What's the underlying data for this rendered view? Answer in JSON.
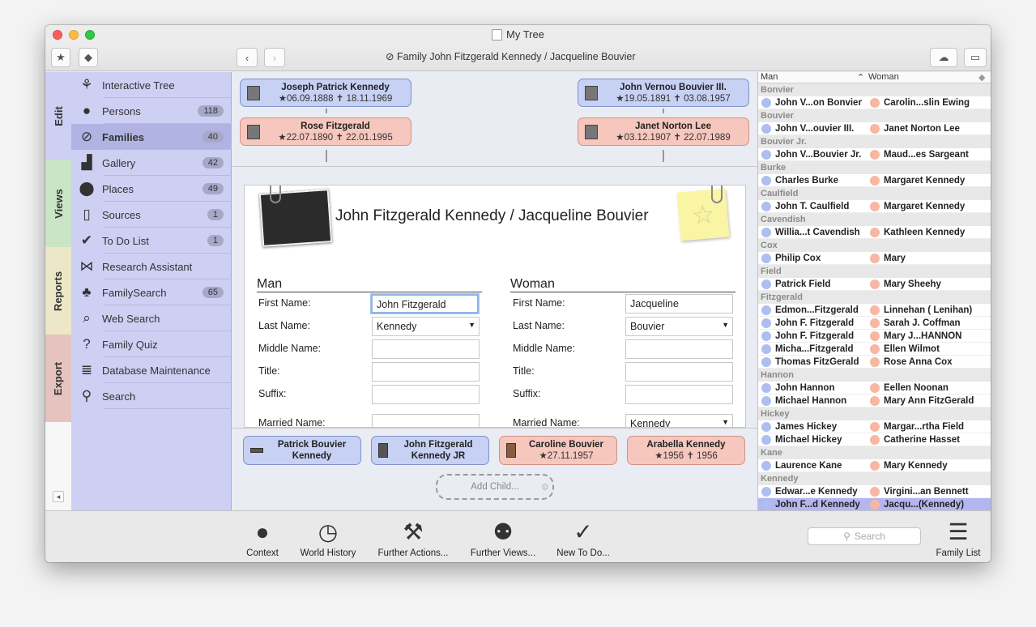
{
  "window": {
    "title": "My Tree"
  },
  "toolbar": {
    "breadcrumb": "Family John Fitzgerald Kennedy / Jacqueline Bouvier"
  },
  "tabs": [
    "Edit",
    "Views",
    "Reports",
    "Export"
  ],
  "sidebar": {
    "items": [
      {
        "label": "Interactive Tree",
        "count": "",
        "icon": "tree-icon"
      },
      {
        "label": "Persons",
        "count": "118",
        "icon": "person-icon"
      },
      {
        "label": "Families",
        "count": "40",
        "icon": "rings-icon"
      },
      {
        "label": "Gallery",
        "count": "42",
        "icon": "gallery-icon"
      },
      {
        "label": "Places",
        "count": "49",
        "icon": "pin-icon"
      },
      {
        "label": "Sources",
        "count": "1",
        "icon": "book-icon"
      },
      {
        "label": "To Do List",
        "count": "1",
        "icon": "check-icon"
      },
      {
        "label": "Research Assistant",
        "count": "",
        "icon": "bowtie-icon"
      },
      {
        "label": "FamilySearch",
        "count": "65",
        "icon": "familysearch-icon"
      },
      {
        "label": "Web Search",
        "count": "",
        "icon": "web-search-icon"
      },
      {
        "label": "Family Quiz",
        "count": "",
        "icon": "question-icon"
      },
      {
        "label": "Database Maintenance",
        "count": "",
        "icon": "database-icon"
      },
      {
        "label": "Search",
        "count": "",
        "icon": "search-icon"
      }
    ]
  },
  "parents": {
    "man_father": {
      "name": "Joseph Patrick Kennedy",
      "dates": "★06.09.1888 ✝ 18.11.1969"
    },
    "man_mother": {
      "name": "Rose Fitzgerald",
      "dates": "★22.07.1890 ✝ 22.01.1995"
    },
    "woman_father": {
      "name": "John Vernou Bouvier III.",
      "dates": "★19.05.1891 ✝ 03.08.1957"
    },
    "woman_mother": {
      "name": "Janet Norton Lee",
      "dates": "★03.12.1907 ✝ 22.07.1989"
    }
  },
  "family": {
    "title": "John Fitzgerald Kennedy / Jacqueline Bouvier"
  },
  "man": {
    "header": "Man",
    "first_name": "John Fitzgerald",
    "last_name": "Kennedy",
    "middle_name": "",
    "title": "",
    "suffix": "",
    "married_name": ""
  },
  "woman": {
    "header": "Woman",
    "first_name": "Jacqueline",
    "last_name": "Bouvier",
    "middle_name": "",
    "title": "",
    "suffix": "",
    "married_name": "Kennedy"
  },
  "labels": {
    "first_name": "First Name:",
    "last_name": "Last Name:",
    "middle_name": "Middle Name:",
    "title": "Title:",
    "suffix": "Suffix:",
    "married_name": "Married Name:"
  },
  "children": [
    {
      "name": "Patrick Bouvier Kennedy",
      "dates": "",
      "gender": "m"
    },
    {
      "name": "John Fitzgerald Kennedy JR",
      "dates": "",
      "gender": "m"
    },
    {
      "name": "Caroline Bouvier",
      "dates": "★27.11.1957",
      "gender": "f"
    },
    {
      "name": "Arabella Kennedy",
      "dates": "★1956 ✝ 1956",
      "gender": "f"
    }
  ],
  "add_child": "Add Child...",
  "family_list": {
    "col_man": "Man",
    "col_woman": "Woman",
    "groups": [
      {
        "name": "Bonvier",
        "rows": [
          [
            "John V...on Bonvier",
            "Carolin...slin Ewing"
          ]
        ]
      },
      {
        "name": "Bouvier",
        "rows": [
          [
            "John V...ouvier III.",
            "Janet Norton Lee"
          ]
        ]
      },
      {
        "name": "Bouvier Jr.",
        "rows": [
          [
            "John V...Bouvier Jr.",
            "Maud...es Sargeant"
          ]
        ]
      },
      {
        "name": "Burke",
        "rows": [
          [
            "Charles Burke",
            "Margaret Kennedy"
          ]
        ]
      },
      {
        "name": "Caulfield",
        "rows": [
          [
            "John T. Caulfield",
            "Margaret Kennedy"
          ]
        ]
      },
      {
        "name": "Cavendish",
        "rows": [
          [
            "Willia...t Cavendish",
            "Kathleen Kennedy"
          ]
        ]
      },
      {
        "name": "Cox",
        "rows": [
          [
            "Philip Cox",
            "Mary"
          ]
        ]
      },
      {
        "name": "Field",
        "rows": [
          [
            "Patrick Field",
            "Mary Sheehy"
          ]
        ]
      },
      {
        "name": "Fitzgerald",
        "rows": [
          [
            "Edmon...Fitzgerald",
            "Linnehan ( Lenihan)"
          ],
          [
            "John F. Fitzgerald",
            "Sarah J. Coffman"
          ],
          [
            "John F. Fitzgerald",
            "Mary J...HANNON"
          ],
          [
            "Micha...Fitzgerald",
            "Ellen Wilmot"
          ],
          [
            "Thomas FitzGerald",
            "Rose Anna Cox"
          ]
        ]
      },
      {
        "name": "Hannon",
        "rows": [
          [
            "John Hannon",
            "Eellen Noonan"
          ],
          [
            "Michael Hannon",
            "Mary Ann FitzGerald"
          ]
        ]
      },
      {
        "name": "Hickey",
        "rows": [
          [
            "James Hickey",
            "Margar...rtha Field"
          ],
          [
            "Michael Hickey",
            "Catherine Hasset"
          ]
        ]
      },
      {
        "name": "Kane",
        "rows": [
          [
            "Laurence Kane",
            "Mary Kennedy"
          ]
        ]
      },
      {
        "name": "Kennedy",
        "rows": [
          [
            "Edwar...e Kennedy",
            "Virgini...an Bennett"
          ],
          [
            "John F...d Kennedy",
            "Jacqu...(Kennedy)"
          ]
        ]
      }
    ]
  },
  "bottom": {
    "buttons": [
      "Context",
      "World History",
      "Further Actions...",
      "Further Views...",
      "New To Do..."
    ],
    "search_placeholder": "Search",
    "family_list_label": "Family List"
  }
}
